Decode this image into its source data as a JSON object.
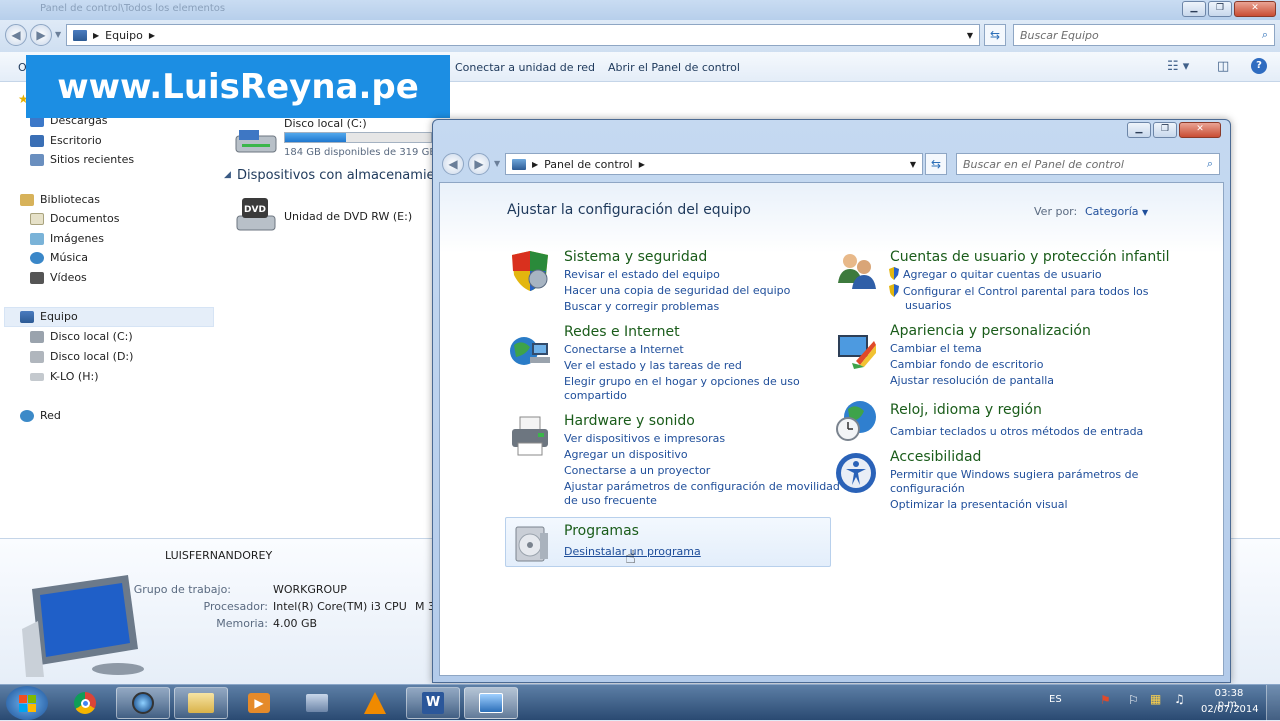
{
  "explorer": {
    "window_title": "Panel de control\\Todos los elementos",
    "breadcrumb": [
      "Equipo"
    ],
    "search_placeholder": "Buscar Equipo",
    "toolbar": {
      "organize_label": "O",
      "map_drive_label": "Conectar a unidad de red",
      "open_cp_label": "Abrir el Panel de control"
    },
    "nav": {
      "favorites": [
        "Descargas",
        "Escritorio",
        "Sitios recientes"
      ],
      "libraries_label": "Bibliotecas",
      "libraries": [
        "Documentos",
        "Imágenes",
        "Música",
        "Vídeos"
      ],
      "computer_label": "Equipo",
      "drives": [
        "Disco local (C:)",
        "Disco local (D:)",
        "K-LO (H:)"
      ],
      "network_label": "Red"
    },
    "content": {
      "drive_c_name": "Disco local (C:)",
      "drive_c_free": "184 GB disponibles de 319 GB",
      "drive_c_fill": 0.42,
      "removable_section": "Dispositivos con almacenamien",
      "dvd_name": "Unidad de DVD RW (E:)",
      "dvd_badge": "DVD"
    },
    "details": {
      "computer_name": "LUISFERNANDOREY",
      "workgroup_label": "Grupo de trabajo:",
      "workgroup_value": "WORKGROUP",
      "processor_label": "Procesador:",
      "processor_value": "Intel(R) Core(TM) i3 CPU",
      "processor_extra": "M 3",
      "memory_label": "Memoria:",
      "memory_value": "4.00 GB"
    }
  },
  "banner": {
    "text": "www.LuisReyna.pe",
    "color": "#1c8ee3"
  },
  "control_panel": {
    "breadcrumb": [
      "Panel de control"
    ],
    "search_placeholder": "Buscar en el Panel de control",
    "heading": "Ajustar la configuración del equipo",
    "view_by_label": "Ver por:",
    "view_by_value": "Categoría",
    "categories": {
      "system": {
        "title": "Sistema y seguridad",
        "links": [
          "Revisar el estado del equipo",
          "Hacer una copia de seguridad del equipo",
          "Buscar y corregir problemas"
        ]
      },
      "network": {
        "title": "Redes e Internet",
        "links": [
          "Conectarse a Internet",
          "Ver el estado y las tareas de red",
          "Elegir grupo en el hogar y opciones de uso",
          "compartido"
        ]
      },
      "hardware": {
        "title": "Hardware y sonido",
        "links": [
          "Ver dispositivos e impresoras",
          "Agregar un dispositivo",
          "Conectarse a un proyector",
          "Ajustar parámetros de configuración de movilidad",
          "de uso frecuente"
        ]
      },
      "programs": {
        "title": "Programas",
        "links": [
          "Desinstalar un programa"
        ]
      },
      "users": {
        "title": "Cuentas de usuario y protección infantil",
        "links": [
          "Agregar o quitar cuentas de usuario",
          "Configurar el Control parental para todos los",
          "usuarios"
        ]
      },
      "appearance": {
        "title": "Apariencia y personalización",
        "links": [
          "Cambiar el tema",
          "Cambiar fondo de escritorio",
          "Ajustar resolución de pantalla"
        ]
      },
      "clock": {
        "title": "Reloj, idioma y región",
        "links": [
          "Cambiar teclados u otros métodos de entrada"
        ]
      },
      "access": {
        "title": "Accesibilidad",
        "links": [
          "Permitir que Windows sugiera parámetros de",
          "configuración",
          "Optimizar la presentación visual"
        ]
      }
    }
  },
  "taskbar": {
    "language": "ES",
    "time": "03:38 p.m.",
    "date": "02/07/2014"
  },
  "colors": {
    "link": "#1f4e9a",
    "category_title": "#1a5c1a",
    "taskbar": "#2a4a72"
  }
}
